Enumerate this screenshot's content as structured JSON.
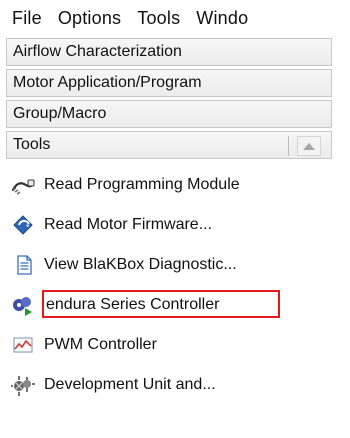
{
  "menu": {
    "items": [
      "File",
      "Options",
      "Tools",
      "Windo"
    ]
  },
  "groups": [
    {
      "label": "Airflow Characterization"
    },
    {
      "label": "Motor Application/Program"
    },
    {
      "label": "Group/Macro"
    },
    {
      "label": "Tools"
    }
  ],
  "tools": {
    "items": [
      {
        "label": "Read Programming Module",
        "icon": "cable-icon"
      },
      {
        "label": "Read Motor Firmware...",
        "icon": "chip-read-icon"
      },
      {
        "label": "View BlaKBox Diagnostic...",
        "icon": "document-icon"
      },
      {
        "label": "endura Series Controller",
        "icon": "motor-controller-icon",
        "selected": true
      },
      {
        "label": "PWM Controller",
        "icon": "pwm-chart-icon"
      },
      {
        "label": "Development Unit and...",
        "icon": "development-unit-icon"
      }
    ]
  },
  "colors": {
    "selection_outline": "#e11b1b",
    "panel_border": "#c9c9c9",
    "text": "#111111"
  }
}
